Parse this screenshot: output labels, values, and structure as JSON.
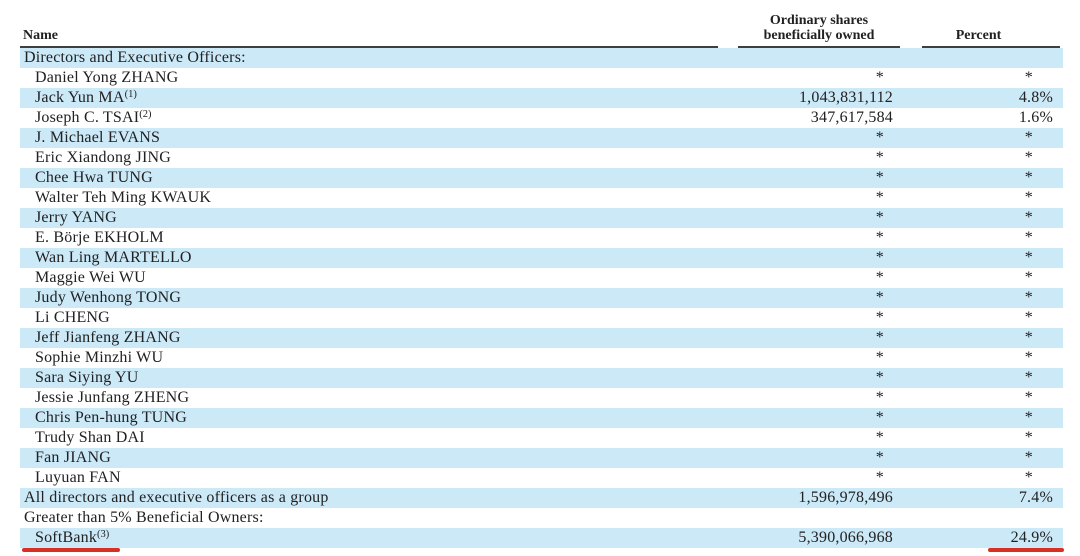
{
  "header": {
    "name": "Name",
    "shares_line1": "Ordinary shares",
    "shares_line2": "beneficially owned",
    "percent": "Percent"
  },
  "rows": [
    {
      "name": "Directors and Executive Officers:",
      "indent": false,
      "shares": "",
      "percent": ""
    },
    {
      "name": "Daniel Yong ZHANG",
      "indent": true,
      "shares": "*",
      "percent": "*"
    },
    {
      "name": "Jack Yun MA",
      "sup": "(1)",
      "indent": true,
      "shares": "1,043,831,112",
      "percent": "4.8%"
    },
    {
      "name": "Joseph C. TSAI",
      "sup": "(2)",
      "indent": true,
      "shares": "347,617,584",
      "percent": "1.6%"
    },
    {
      "name": "J. Michael EVANS",
      "indent": true,
      "shares": "*",
      "percent": "*"
    },
    {
      "name": "Eric Xiandong JING",
      "indent": true,
      "shares": "*",
      "percent": "*"
    },
    {
      "name": "Chee Hwa TUNG",
      "indent": true,
      "shares": "*",
      "percent": "*"
    },
    {
      "name": "Walter Teh Ming KWAUK",
      "indent": true,
      "shares": "*",
      "percent": "*"
    },
    {
      "name": "Jerry YANG",
      "indent": true,
      "shares": "*",
      "percent": "*"
    },
    {
      "name": "E. Börje EKHOLM",
      "indent": true,
      "shares": "*",
      "percent": "*"
    },
    {
      "name": "Wan Ling MARTELLO",
      "indent": true,
      "shares": "*",
      "percent": "*"
    },
    {
      "name": "Maggie Wei WU",
      "indent": true,
      "shares": "*",
      "percent": "*"
    },
    {
      "name": "Judy Wenhong TONG",
      "indent": true,
      "shares": "*",
      "percent": "*"
    },
    {
      "name": "Li CHENG",
      "indent": true,
      "shares": "*",
      "percent": "*"
    },
    {
      "name": "Jeff Jianfeng ZHANG",
      "indent": true,
      "shares": "*",
      "percent": "*"
    },
    {
      "name": "Sophie Minzhi WU",
      "indent": true,
      "shares": "*",
      "percent": "*"
    },
    {
      "name": "Sara Siying YU",
      "indent": true,
      "shares": "*",
      "percent": "*"
    },
    {
      "name": "Jessie Junfang ZHENG",
      "indent": true,
      "shares": "*",
      "percent": "*"
    },
    {
      "name": "Chris Pen-hung TUNG",
      "indent": true,
      "shares": "*",
      "percent": "*"
    },
    {
      "name": "Trudy Shan DAI",
      "indent": true,
      "shares": "*",
      "percent": "*"
    },
    {
      "name": "Fan JIANG",
      "indent": true,
      "shares": "*",
      "percent": "*"
    },
    {
      "name": "Luyuan FAN",
      "indent": true,
      "shares": "*",
      "percent": "*"
    },
    {
      "name": "All directors and executive officers as a group",
      "indent": false,
      "shares": "1,596,978,496",
      "percent": "7.4%"
    },
    {
      "name": "Greater than 5% Beneficial Owners:",
      "indent": false,
      "shares": "",
      "percent": ""
    },
    {
      "name": "SoftBank",
      "sup": "(3)",
      "indent": true,
      "shares": "5,390,066,968",
      "percent": "24.9%"
    }
  ],
  "annotations": [
    {
      "type": "red-underline",
      "target": "SoftBank(3)"
    },
    {
      "type": "red-underline",
      "target": "24.9%"
    }
  ],
  "colors": {
    "row_highlight": "#cce9f8",
    "red_underline": "#d93025",
    "header_rule": "#3f3f3f",
    "text": "#212121"
  }
}
